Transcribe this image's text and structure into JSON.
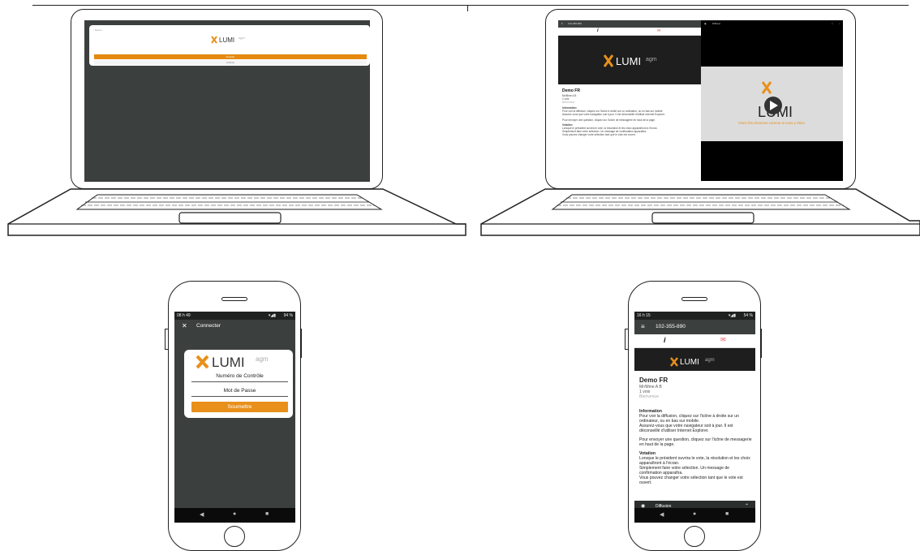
{
  "laptop_login": {
    "back_label": "Retour",
    "logo_text": "LUMI",
    "logo_suffix": "agm",
    "submit_label": "Accéder",
    "secondary_label": "Archive"
  },
  "laptop_meeting": {
    "meeting_id": "102-355-890",
    "broadcast_label": "Diffuser",
    "logo_text": "LUMI",
    "logo_suffix": "agm",
    "title": "Demo FR",
    "user": "Mr/Mme A B",
    "votes": "1 voix",
    "welcome": "Bienvenue",
    "info_heading": "Information",
    "info_1": "Pour voir la diffusion, cliquez sur l'icône à droite sur un ordinateur, ou en bas sur mobile.",
    "info_2": "Assurez-vous que votre navigateur soit à jour. Il est déconseillé d'utiliser Internet Explorer.",
    "info_3": "Pour envoyer une question, cliquez sur l'icône de messagerie en haut de la page.",
    "vote_heading": "Votation",
    "vote_1": "Lorsque le président ouvrira le vote, la résolution et les choix apparaîtront à l'écran.",
    "vote_2": "Simplement faire votre sélection. Un message de confirmation apparaîtra.",
    "vote_3": "Vous pouvez changer votre sélection tant que le vote est ouvert.",
    "video_caption": "Vivez les réunions comme si vous y étiez."
  },
  "phone_login": {
    "time": "08 h 49",
    "battery": "94 %",
    "title": "Connecter",
    "logo_text": "LUMI",
    "logo_suffix": "agm",
    "field_control": "Numéro de Contrôle",
    "field_password": "Mot de Passe",
    "submit_label": "Soumettre"
  },
  "phone_meeting": {
    "time": "16 h 15",
    "battery": "54 %",
    "meeting_id": "102-355-890",
    "logo_text": "LUMI",
    "logo_suffix": "agm",
    "title": "Demo FR",
    "user": "Mr/Mme A B",
    "votes": "1 voix",
    "welcome": "Bienvenue",
    "info_heading": "Information",
    "info_1": "Pour voir la diffusion, cliquez sur l'icône à droite sur un ordinateur, ou en bas sur mobile.",
    "info_2": "Assurez-vous que votre navigateur soit à jour. Il est déconseillé d'utiliser Internet Explorer.",
    "info_3": "Pour envoyer une question, cliquez sur l'icône de messagerie en haut de la page.",
    "vote_heading": "Votation",
    "vote_1": "Lorsque le président ouvrira le vote, la résolution et les choix apparaîtront à l'écran.",
    "vote_2": "Simplement faire votre sélection. Un message de confirmation apparaîtra.",
    "vote_3": "Vous pouvez changer votre sélection tant que le vote est ouvert.",
    "broadcast_label": "Diffusion"
  },
  "colors": {
    "accent": "#e8901a",
    "screen_bg": "#3b3f3e",
    "banner_bg": "#1e1e1e"
  },
  "icons": [
    "close-icon",
    "menu-icon",
    "info-icon",
    "chat-icon",
    "broadcast-icon",
    "chevron-up-icon",
    "play-icon",
    "back-nav-icon",
    "home-nav-icon",
    "recents-nav-icon"
  ]
}
